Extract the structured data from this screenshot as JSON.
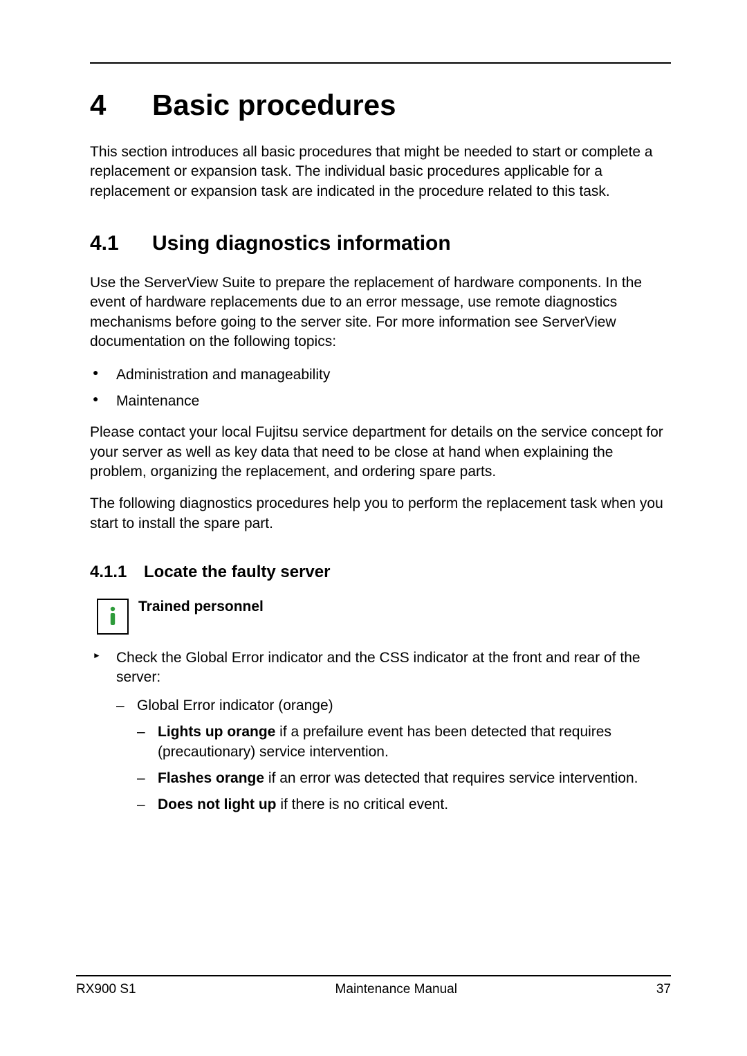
{
  "chapter": {
    "number": "4",
    "title": "Basic procedures"
  },
  "intro": "This section introduces all basic procedures that might be needed to start or complete a replacement or expansion task. The individual basic procedures applicable for a replacement or expansion task are indicated in the procedure related to this task.",
  "section": {
    "number": "4.1",
    "title": "Using diagnostics information",
    "p1": "Use the ServerView Suite to prepare the replacement of hardware components. In the event of hardware replacements due to an error message, use remote diagnostics mechanisms before going to the server site. For more information see ServerView documentation on the following topics:",
    "bullets": [
      "Administration and manageability",
      "Maintenance"
    ],
    "p2": "Please contact your local Fujitsu service department for details on the service concept for your server as well as key data that need to be close at hand when explaining the problem, organizing the replacement, and ordering spare parts.",
    "p3": "The following diagnostics procedures help you to perform the replacement task when you start to install the spare part."
  },
  "subsection": {
    "number": "4.1.1",
    "title": "Locate the faulty server",
    "info_label": "Trained personnel",
    "step_intro": "Check the Global Error indicator and the CSS indicator at the front and rear of the server:",
    "level1_item": "Global Error indicator (orange)",
    "states": {
      "s1_bold": "Lights up orange",
      "s1_rest": " if a prefailure event has been detected that requires (precautionary) service intervention.",
      "s2_bold": "Flashes orange",
      "s2_rest": " if an error was detected that requires service intervention.",
      "s3_bold": "Does not light up",
      "s3_rest": " if there is no critical event."
    }
  },
  "footer": {
    "left": "RX900 S1",
    "center": "Maintenance Manual",
    "right": "37"
  }
}
